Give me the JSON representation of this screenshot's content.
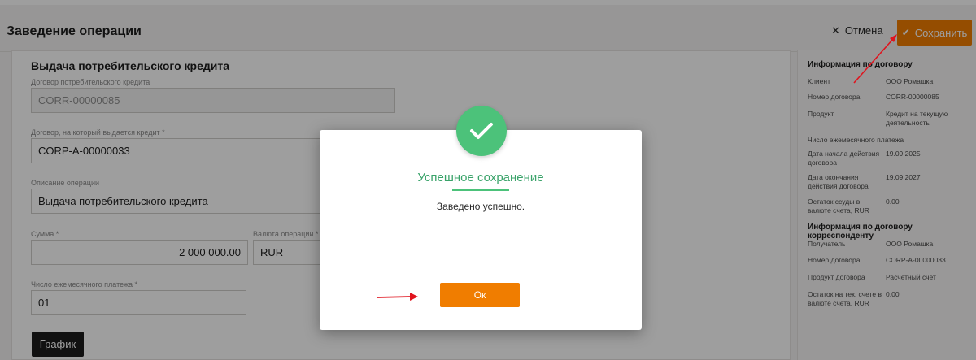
{
  "header": {
    "title": "Заведение операции",
    "cancel_label": "Отмена",
    "save_label": "Сохранить"
  },
  "form": {
    "title": "Выдача потребительского кредита",
    "fields": {
      "contract": {
        "label": "Договор потребительского кредита",
        "value": "CORR-00000085"
      },
      "target_contract": {
        "label": "Договор, на который выдается кредит *",
        "value": "CORP-A-00000033"
      },
      "description": {
        "label": "Описание операции",
        "value": "Выдача потребительского кредита"
      },
      "amount": {
        "label": "Сумма *",
        "value": "2 000 000.00"
      },
      "currency": {
        "label": "Валюта операции *",
        "value": "RUR"
      },
      "monthly_day": {
        "label": "Число ежемесячного платежа *",
        "value": "01"
      }
    },
    "schedule_label": "График"
  },
  "info": {
    "contract_title": "Информация по договору",
    "contract_rows": [
      {
        "label": "Клиент",
        "value": "ООО Ромашка"
      },
      {
        "label": "Номер договора",
        "value": "CORR-00000085"
      },
      {
        "label": "Продукт",
        "value": "Кредит на текущую деятельность"
      },
      {
        "label": "Число ежемесячного платежа",
        "value": ""
      },
      {
        "label": "Дата начала действия договора",
        "value": "19.09.2025"
      },
      {
        "label": "Дата окончания действия договора",
        "value": "19.09.2027"
      },
      {
        "label": "Остаток ссуды в валюте счета, RUR",
        "value": "0.00"
      }
    ],
    "corr_title": "Информация по договору корреспонденту",
    "corr_rows": [
      {
        "label": "Получатель",
        "value": "ООО Ромашка"
      },
      {
        "label": "Номер договора",
        "value": "CORP-A-00000033"
      },
      {
        "label": "Продукт договора",
        "value": "Расчетный счет"
      },
      {
        "label": "Остаток на тек. счете в валюте счета, RUR",
        "value": "0.00"
      }
    ]
  },
  "modal": {
    "title": "Успешное сохранение",
    "message": "Заведено успешно.",
    "ok_label": "Ок"
  },
  "colors": {
    "accent_orange": "#f07d00",
    "success_green": "#4cc27a",
    "annotation_red": "#e0141e"
  },
  "icons": {
    "cancel": "close-icon",
    "save": "check-icon",
    "success": "check-circle-icon"
  }
}
